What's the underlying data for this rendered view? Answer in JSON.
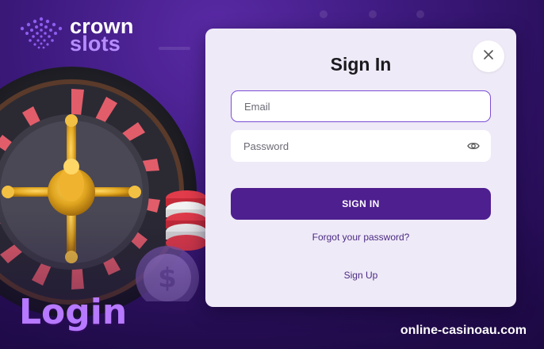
{
  "brand": {
    "name_top": "crown",
    "name_bottom": "slots"
  },
  "background": {
    "heading": "Login",
    "watermark": "online-casinoau.com"
  },
  "modal": {
    "title": "Sign In",
    "email": {
      "placeholder": "Email",
      "value": ""
    },
    "password": {
      "placeholder": "Password",
      "value": ""
    },
    "submit_label": "SIGN IN",
    "forgot_label": "Forgot your password?",
    "signup_label": "Sign Up",
    "close_icon": "close-icon",
    "eye_icon": "eye-icon"
  },
  "colors": {
    "accent": "#4e1f8f",
    "focus_border": "#7b4fd6",
    "modal_bg": "#efeaf7",
    "heading_purple": "#b679ff",
    "logo_slots": "#b68cff"
  }
}
